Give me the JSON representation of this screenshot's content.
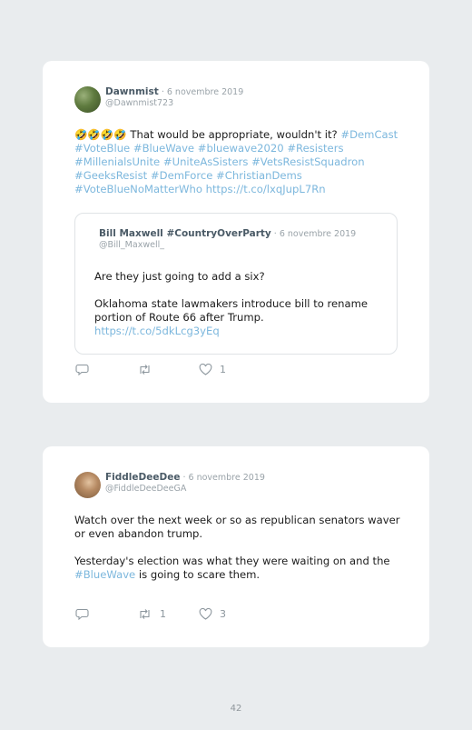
{
  "tweets": [
    {
      "author": "Dawnmist",
      "separator": " · ",
      "date": "6 novembre 2019",
      "handle": "@Dawnmist723",
      "emoji": "🤣🤣🤣🤣",
      "text_plain": " That would be appropriate, wouldn't it? ",
      "hashtags": [
        "#DemCast",
        "#VoteBlue",
        "#BlueWave",
        "#bluewave2020",
        "#Resisters",
        "#MillenialsUnite",
        "#UniteAsSisters",
        "#VetsResistSquadron",
        "#GeeksResist",
        "#DemForce",
        "#ChristianDems",
        "#VoteBlueNoMatterWho"
      ],
      "link": "https://t.co/lxqJupL7Rn",
      "quoted": {
        "author": "Bill Maxwell #CountryOverParty",
        "separator": " · ",
        "date": "6 novembre 2019",
        "handle": "@Bill_Maxwell_",
        "line1": "Are they just going to add a six?",
        "line2": "Oklahoma state lawmakers introduce bill to rename portion of Route 66 after Trump.",
        "link": "https://t.co/5dkLcg3yEq"
      },
      "retweets": "",
      "likes": "1"
    },
    {
      "author": "FiddleDeeDee",
      "separator": " · ",
      "date": "6 novembre 2019",
      "handle": "@FiddleDeeDeeGA",
      "para1": "Watch over the next week or so as republican senators waver or even abandon trump.",
      "para2_a": "Yesterday's election was what they were waiting on and the ",
      "para2_tag": "#BlueWave",
      "para2_b": " is going to scare them.",
      "retweets": "1",
      "likes": "3"
    }
  ],
  "page_number": "42",
  "colors": {
    "link": "#7cb7dd",
    "background": "#e9ecee",
    "card": "#ffffff",
    "name": "#4a5a66",
    "muted": "#9aa3a9"
  },
  "icons": [
    "reply-icon",
    "retweet-icon",
    "heart-icon"
  ]
}
